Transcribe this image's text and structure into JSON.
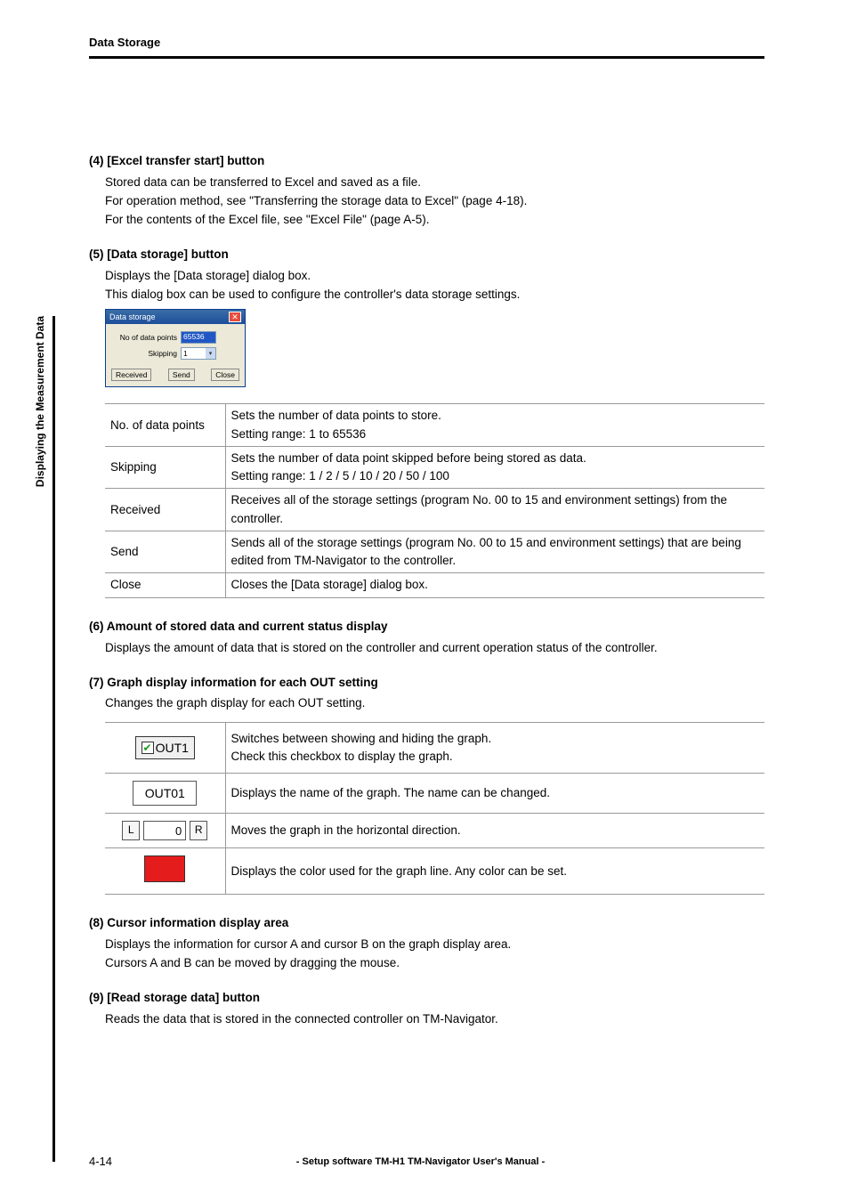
{
  "header": {
    "title": "Data Storage"
  },
  "side_label": "Displaying the Measurement Data",
  "sections": {
    "s4": {
      "title": "(4) [Excel transfer start] button",
      "line1": "Stored data can be transferred to Excel and saved as a file.",
      "line2": "For operation method, see \"Transferring the storage data to Excel\" (page 4-18).",
      "line3": "For the contents of the Excel file, see \"Excel File\" (page A-5)."
    },
    "s5": {
      "title": "(5) [Data storage] button",
      "line1": "Displays the [Data storage] dialog box.",
      "line2": "This dialog box can be used to configure the controller's data storage settings."
    },
    "s6": {
      "title": "(6) Amount of stored data and current status display",
      "line1": "Displays the amount of data that is stored on the controller and current operation status of the controller."
    },
    "s7": {
      "title": "(7) Graph display information for each OUT setting",
      "line1": "Changes the graph display for each OUT setting."
    },
    "s8": {
      "title": "(8) Cursor information display area",
      "line1": "Displays the information for cursor A and cursor B on the graph display area.",
      "line2": "Cursors A and B can be moved by dragging the mouse."
    },
    "s9": {
      "title": "(9) [Read storage data] button",
      "line1": "Reads the data that is stored in the connected controller on TM-Navigator."
    }
  },
  "dialog": {
    "title": "Data storage",
    "close": "✕",
    "points_label": "No of data points",
    "points_value": "65536",
    "skipping_label": "Skipping",
    "skipping_value": "1",
    "btn_received": "Received",
    "btn_send": "Send",
    "btn_close": "Close"
  },
  "param_table": {
    "r1": {
      "label": "No. of data points",
      "desc1": "Sets the number of data points to store.",
      "desc2": "Setting range: 1 to 65536"
    },
    "r2": {
      "label": "Skipping",
      "desc1": "Sets the number of data point skipped before being stored as data.",
      "desc2": "Setting range: 1 / 2 / 5 / 10 / 20 / 50 / 100"
    },
    "r3": {
      "label": "Received",
      "desc": "Receives all of the storage settings (program No. 00 to 15 and environment settings) from the controller."
    },
    "r4": {
      "label": "Send",
      "desc": "Sends all of the storage settings (program No. 00 to 15 and environment settings) that are being edited from TM-Navigator to the controller."
    },
    "r5": {
      "label": "Close",
      "desc": "Closes the [Data storage] dialog box."
    }
  },
  "ui_table": {
    "r1": {
      "check_label": "OUT1",
      "desc1": "Switches between showing  and  hiding the graph.",
      "desc2": "Check this checkbox to display the graph."
    },
    "r2": {
      "field_value": "OUT01",
      "desc": "Displays the name of the graph. The name can be changed."
    },
    "r3": {
      "btn_l": "L",
      "val": "0",
      "btn_r": "R",
      "desc": "Moves the graph in the horizontal direction."
    },
    "r4": {
      "color": "#e51c1c",
      "desc": "Displays the color used for the graph line. Any color can be set."
    }
  },
  "footer": {
    "page": "4-14",
    "center": "- Setup software TM-H1 TM-Navigator User's Manual -"
  }
}
